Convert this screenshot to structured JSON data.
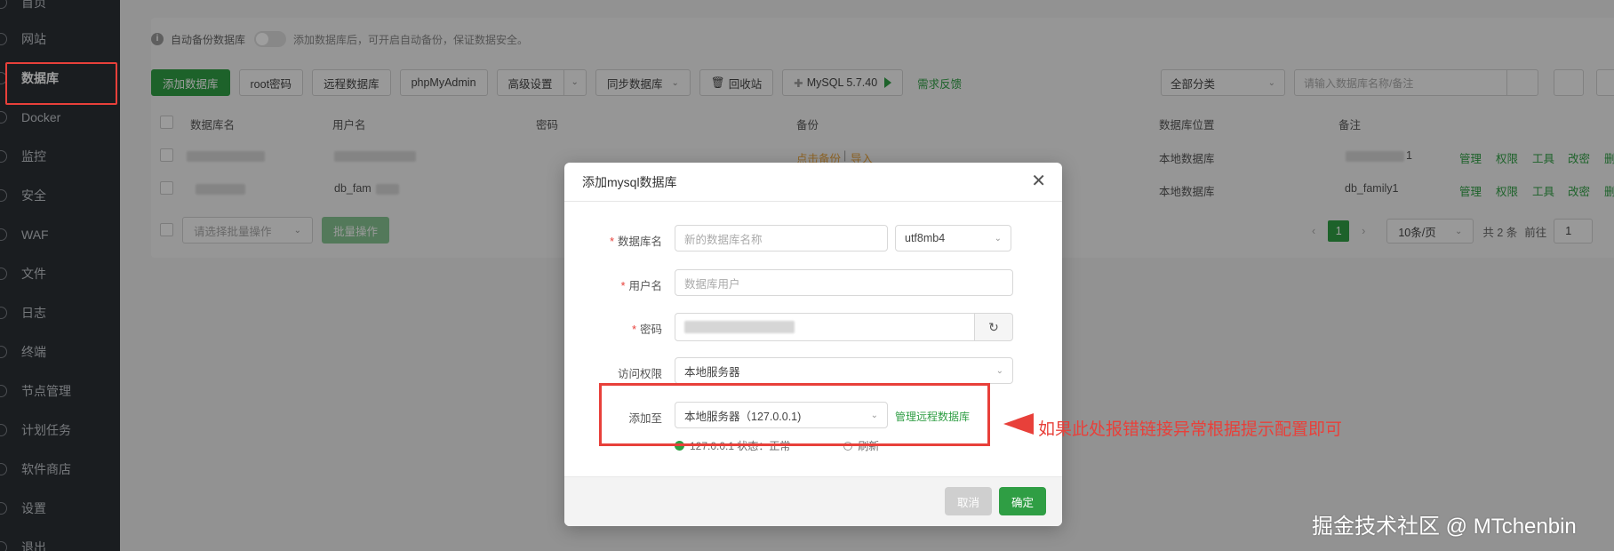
{
  "sidebar": {
    "items": [
      {
        "label": "首页",
        "name": "home"
      },
      {
        "label": "网站",
        "name": "website"
      },
      {
        "label": "数据库",
        "name": "database",
        "active": true
      },
      {
        "label": "Docker",
        "name": "docker"
      },
      {
        "label": "监控",
        "name": "monitor"
      },
      {
        "label": "安全",
        "name": "security"
      },
      {
        "label": "WAF",
        "name": "waf"
      },
      {
        "label": "文件",
        "name": "files"
      },
      {
        "label": "日志",
        "name": "logs"
      },
      {
        "label": "终端",
        "name": "terminal"
      },
      {
        "label": "节点管理",
        "name": "nodes"
      },
      {
        "label": "计划任务",
        "name": "cron"
      },
      {
        "label": "软件商店",
        "name": "store"
      },
      {
        "label": "设置",
        "name": "settings"
      },
      {
        "label": "退出",
        "name": "logout"
      }
    ]
  },
  "notice": {
    "label": "自动备份数据库",
    "text": "添加数据库后，可开启自动备份，保证数据安全。"
  },
  "toolbar": {
    "add_db": "添加数据库",
    "root_pw": "root密码",
    "remote_db": "远程数据库",
    "phpmyadmin": "phpMyAdmin",
    "advanced": "高级设置",
    "sync": "同步数据库",
    "recycle": "回收站",
    "mysql_version": "MySQL 5.7.40",
    "feedback": "需求反馈",
    "category": "全部分类",
    "search_placeholder": "请输入数据库名称/备注"
  },
  "table": {
    "headers": {
      "name": "数据库名",
      "user": "用户名",
      "password": "密码",
      "backup": "备份",
      "location": "数据库位置",
      "note": "备注"
    },
    "rows": [
      {
        "user": "",
        "backup_link": "点击备份",
        "import_link": "导入",
        "location": "本地数据库",
        "note": "1"
      },
      {
        "user": "db_fam",
        "location": "本地数据库",
        "note": "db_family1"
      }
    ],
    "actions": [
      "管理",
      "权限",
      "工具",
      "改密",
      "删"
    ]
  },
  "bottom": {
    "batch_placeholder": "请选择批量操作",
    "batch_btn": "批量操作",
    "page": "1",
    "per_page": "10条/页",
    "total": "共 2 条",
    "goto": "前往",
    "goto_value": "1"
  },
  "modal": {
    "title": "添加mysql数据库",
    "db_name_label": "数据库名",
    "db_name_placeholder": "新的数据库名称",
    "charset": "utf8mb4",
    "user_label": "用户名",
    "user_placeholder": "数据库用户",
    "pw_label": "密码",
    "access_label": "访问权限",
    "access_value": "本地服务器",
    "addto_label": "添加至",
    "addto_value": "本地服务器（127.0.0.1)",
    "manage_remote": "管理远程数据库",
    "status_text": "127.0.0.1 状态：正常",
    "refresh": "刷新",
    "cancel": "取消",
    "ok": "确定"
  },
  "annotation": "如果此处报错链接异常根据提示配置即可",
  "watermark": "掘金技术社区 @ MTchenbin",
  "colors": {
    "accent": "#2f9e44",
    "highlight": "#e8403a",
    "sidebar_bg": "#2b2f35"
  }
}
